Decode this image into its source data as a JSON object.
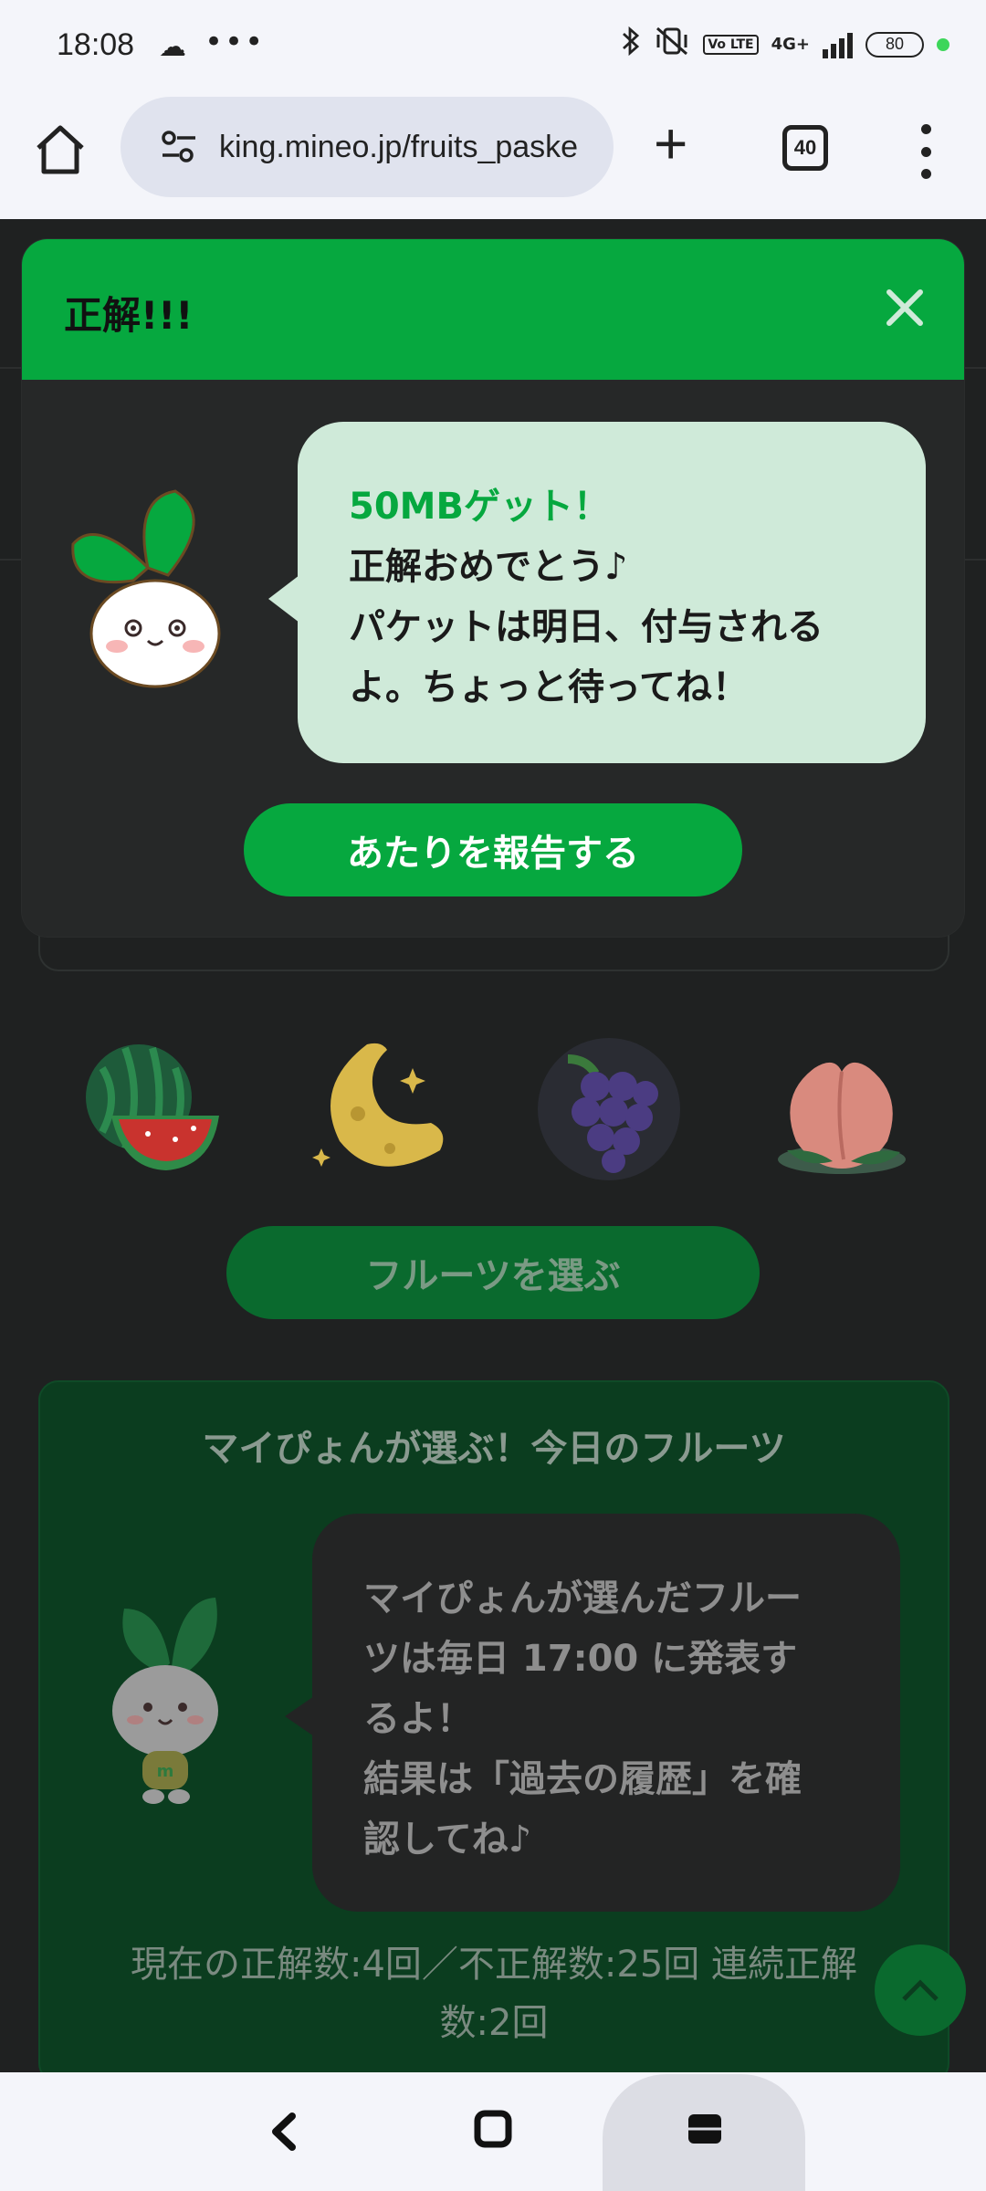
{
  "status": {
    "time": "18:08",
    "dots": "•••",
    "network": "4G+",
    "lte": "Vo LTE",
    "battery": "80"
  },
  "browser": {
    "url": "king.mineo.jp/fruits_paske",
    "tab_count": "40"
  },
  "modal": {
    "title": "正解!!!",
    "message_highlight": "50MBゲット！",
    "message_line1": "正解おめでとう♪",
    "message_line2": "パケットは明日、付与される",
    "message_line3": "よ。ちょっと待ってね！",
    "report_button": "あたりを報告する"
  },
  "fruits": {
    "items": [
      "watermelon",
      "moon",
      "grape",
      "peach"
    ],
    "choose_button": "フルーツを選ぶ"
  },
  "mypyon": {
    "title": "マイぴょんが選ぶ！今日のフルーツ",
    "line1": "マイぴょんが選んだフルー",
    "line2": "ツは毎日 17:00 に発表す",
    "line3": "るよ！",
    "line4": "結果は「過去の履歴」を確",
    "line5": "認してね♪",
    "stats_line1": "現在の正解数:4回／不正解数:25回 連続正解",
    "stats_line2": "数:2回"
  },
  "colors": {
    "accent_green": "#06a83f",
    "bubble_light": "#cfead9"
  }
}
